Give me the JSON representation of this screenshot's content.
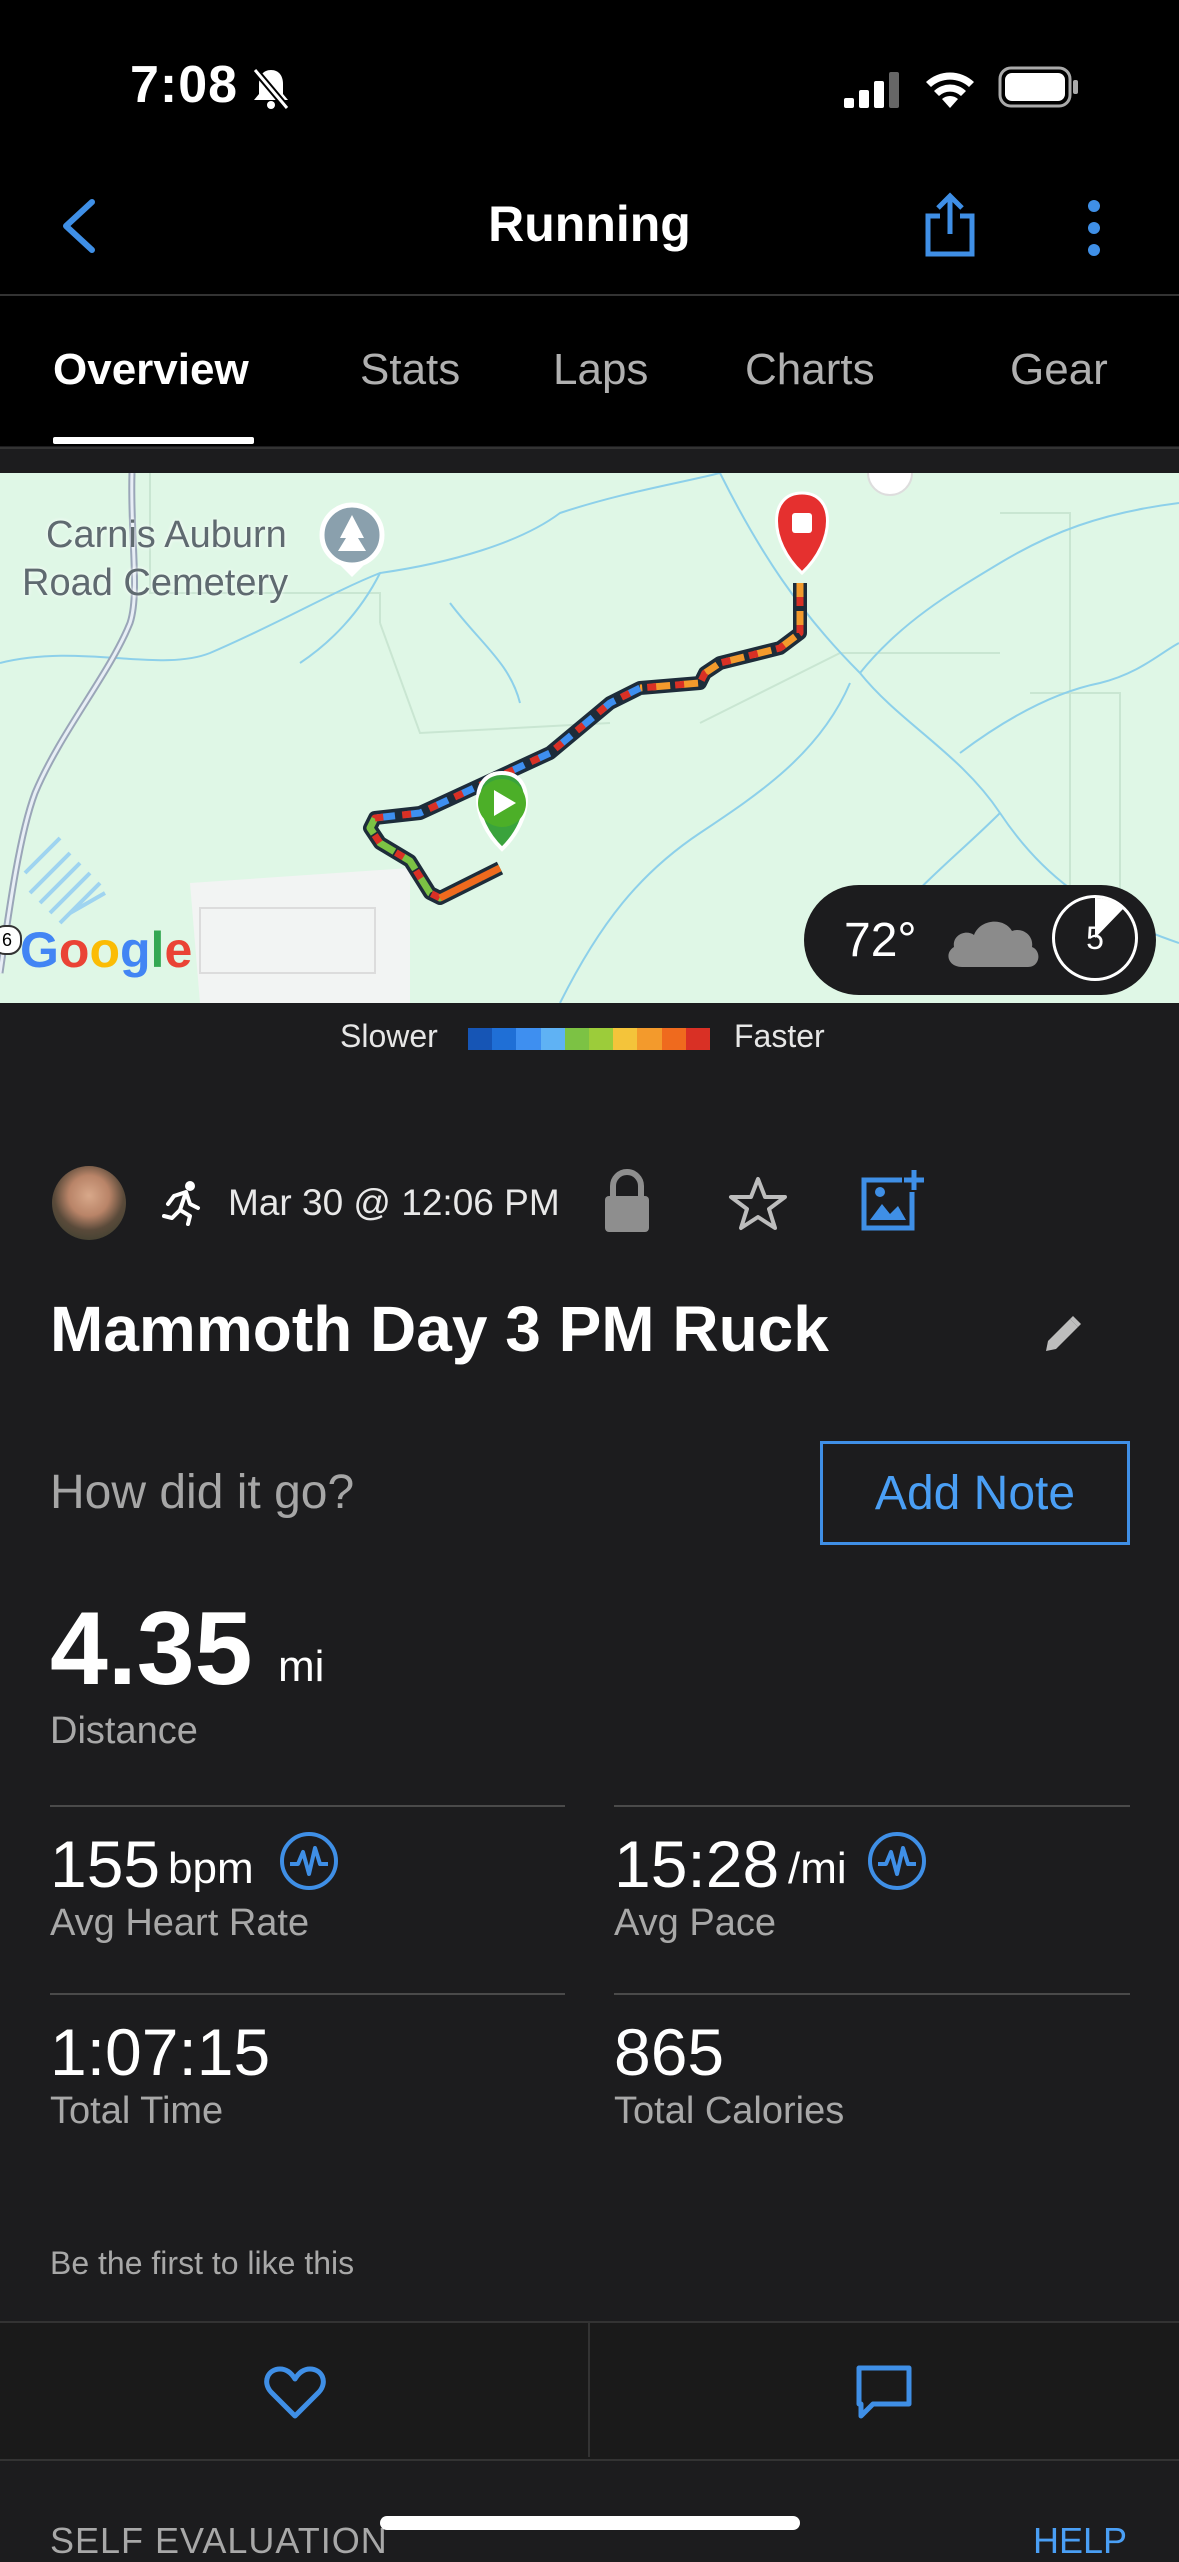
{
  "status_bar": {
    "time": "7:08"
  },
  "header": {
    "title": "Running"
  },
  "tabs": [
    {
      "label": "Overview"
    },
    {
      "label": "Stats"
    },
    {
      "label": "Laps"
    },
    {
      "label": "Charts"
    },
    {
      "label": "Gear"
    }
  ],
  "map": {
    "place_label_line1": "Carnis Auburn",
    "place_label_line2": "Road Cemetery",
    "provider": "Google",
    "temperature": "72°",
    "weather_icon": "cloud-icon",
    "time_badge": "5",
    "badge_left_edge_text": "6"
  },
  "legend": {
    "slower": "Slower",
    "faster": "Faster",
    "colors": [
      "#1655b5",
      "#1f6fd6",
      "#3e8ff0",
      "#5fb2f4",
      "#7cc244",
      "#9ccc3a",
      "#f4c43a",
      "#f39a2c",
      "#ef6a1e",
      "#d93025"
    ]
  },
  "activity": {
    "date": "Mar 30 @ 12:06 PM",
    "title": "Mammoth Day 3 PM Ruck",
    "question": "How did it go?",
    "add_note": "Add Note"
  },
  "stats": {
    "distance": {
      "value": "4.35",
      "unit": "mi",
      "label": "Distance"
    },
    "heart_rate": {
      "value": "155",
      "unit": "bpm",
      "label": "Avg Heart Rate"
    },
    "pace": {
      "value": "15:28",
      "unit": "/mi",
      "label": "Avg Pace"
    },
    "time": {
      "value": "1:07:15",
      "label": "Total Time"
    },
    "calories": {
      "value": "865",
      "label": "Total Calories"
    }
  },
  "social": {
    "likes_text": "Be the first to like this"
  },
  "footer": {
    "self_evaluation": "SELF EVALUATION",
    "help": "HELP"
  },
  "colors": {
    "accent": "#4a9ff5",
    "background": "#1c1c1e",
    "map_bg": "#dff7e6"
  }
}
